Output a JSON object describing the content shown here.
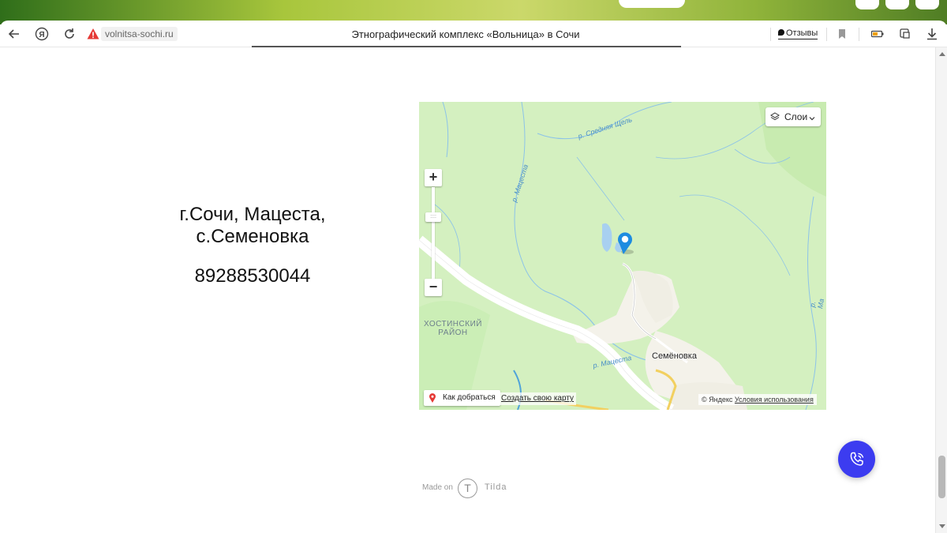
{
  "browser": {
    "url": "volnitsa-sochi.ru",
    "tab_title": "Этнографический комплекс «Вольница» в Сочи",
    "reviews_label": "Отзывы"
  },
  "contact": {
    "address_line1": "г.Сочи, Мацеста,",
    "address_line2": "с.Семеновка",
    "phone": "89288530044"
  },
  "map": {
    "layers_label": "Слои",
    "zoom_in": "+",
    "zoom_out": "−",
    "route_label": "Как добраться",
    "create_map_label": "Создать свою карту",
    "copyright": "© Яндекс",
    "terms_label": "Условия использования",
    "district_line1": "ХОСТИНСКИЙ",
    "district_line2": "РАЙОН",
    "village": "Семёновка",
    "river_sred": "р. Средняя Щель",
    "river_matsesta_1": "р. Мацеста",
    "river_matsesta_2": "р. Мацеста",
    "river_edge": "р. Ма",
    "colors": {
      "land": "#d4f0c0",
      "road": "#ffffff",
      "river": "#7ab8e6",
      "pin": "#1e8ce0"
    }
  },
  "footer": {
    "made_on": "Made on",
    "tilda": "Tilda"
  },
  "colors": {
    "call_button": "#3c3cf0"
  }
}
